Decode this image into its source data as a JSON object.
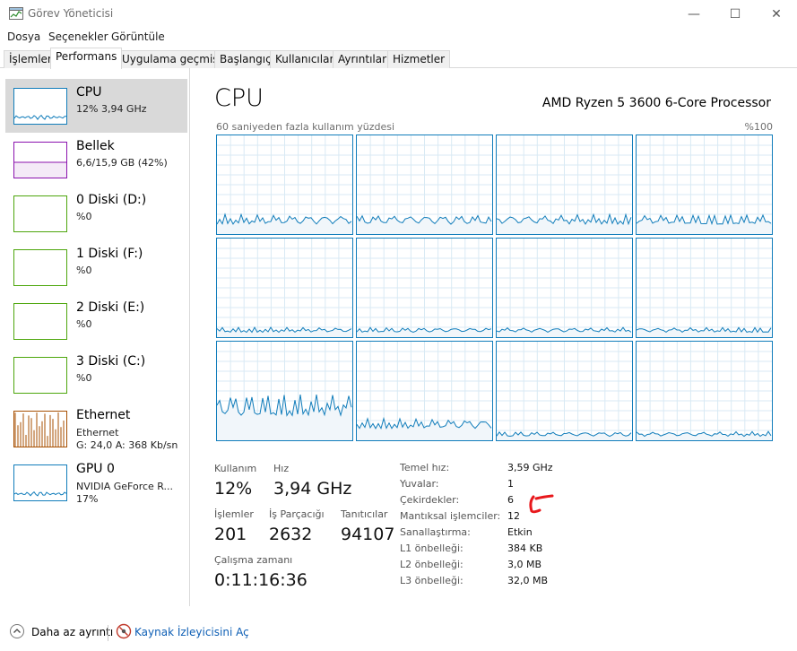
{
  "window": {
    "title": "Görev Yöneticisi",
    "minimize_glyph": "—",
    "maximize_glyph": "☐",
    "close_glyph": "✕"
  },
  "menu": [
    "Dosya",
    "Seçenekler",
    "Görüntüle"
  ],
  "tabs": [
    {
      "label": "İşlemler",
      "active": false
    },
    {
      "label": "Performans",
      "active": true
    },
    {
      "label": "Uygulama geçmişi",
      "active": false
    },
    {
      "label": "Başlangıç",
      "active": false
    },
    {
      "label": "Kullanıcılar",
      "active": false
    },
    {
      "label": "Ayrıntılar",
      "active": false
    },
    {
      "label": "Hizmetler",
      "active": false
    }
  ],
  "sidebar": [
    {
      "name": "CPU",
      "line1": "12% 3,94 GHz",
      "line2": "",
      "color": "#117dbb",
      "icon": "cpu-graph-icon"
    },
    {
      "name": "Bellek",
      "line1": "6,6/15,9 GB (42%)",
      "line2": "",
      "color": "#8b12ae",
      "icon": "memory-graph-icon"
    },
    {
      "name": "0 Diski (D:)",
      "line1": "%0",
      "line2": "",
      "color": "#4da60c",
      "icon": "disk-graph-icon"
    },
    {
      "name": "1 Diski (F:)",
      "line1": "%0",
      "line2": "",
      "color": "#4da60c",
      "icon": "disk-graph-icon"
    },
    {
      "name": "2 Diski (E:)",
      "line1": "%0",
      "line2": "",
      "color": "#4da60c",
      "icon": "disk-graph-icon"
    },
    {
      "name": "3 Diski (C:)",
      "line1": "%0",
      "line2": "",
      "color": "#4da60c",
      "icon": "disk-graph-icon"
    },
    {
      "name": "Ethernet",
      "line1": "Ethernet",
      "line2": "G: 24,0  A: 368 Kb/sn",
      "color": "#a74f01",
      "icon": "ethernet-graph-icon"
    },
    {
      "name": "GPU 0",
      "line1": "NVIDIA GeForce R...",
      "line2": "17%",
      "color": "#117dbb",
      "icon": "gpu-graph-icon"
    }
  ],
  "main": {
    "title": "CPU",
    "model": "AMD Ryzen 5 3600 6-Core Processor",
    "graph_label": "60 saniyeden fazla kullanım yüzdesi",
    "graph_max": "%100",
    "graph_color": "#117dbb",
    "grid_color": "#d9eaf4",
    "fill_color": "#f1f6fa"
  },
  "stats": {
    "usage_label": "Kullanım",
    "usage_value": "12%",
    "speed_label": "Hız",
    "speed_value": "3,94 GHz",
    "processes_label": "İşlemler",
    "processes_value": "201",
    "threads_label": "İş Parçacığı",
    "threads_value": "2632",
    "handles_label": "Tanıtıcılar",
    "handles_value": "94107",
    "uptime_label": "Çalışma zamanı",
    "uptime_value": "0:11:16:36"
  },
  "specs": [
    {
      "label": "Temel hız:",
      "value": "3,59 GHz"
    },
    {
      "label": "Yuvalar:",
      "value": "1"
    },
    {
      "label": "Çekirdekler:",
      "value": "6"
    },
    {
      "label": "Mantıksal işlemciler:",
      "value": "12"
    },
    {
      "label": "Sanallaştırma:",
      "value": "Etkin"
    },
    {
      "label": "L1 önbelleği:",
      "value": "384 KB"
    },
    {
      "label": "L2 önbelleği:",
      "value": "3,0 MB"
    },
    {
      "label": "L3 önbelleği:",
      "value": "32,0 MB"
    }
  ],
  "footer": {
    "less_detail": "Daha az ayrıntı",
    "resource_monitor": "Kaynak İzleyicisini Aç"
  },
  "annotation_color": "#e8181c"
}
